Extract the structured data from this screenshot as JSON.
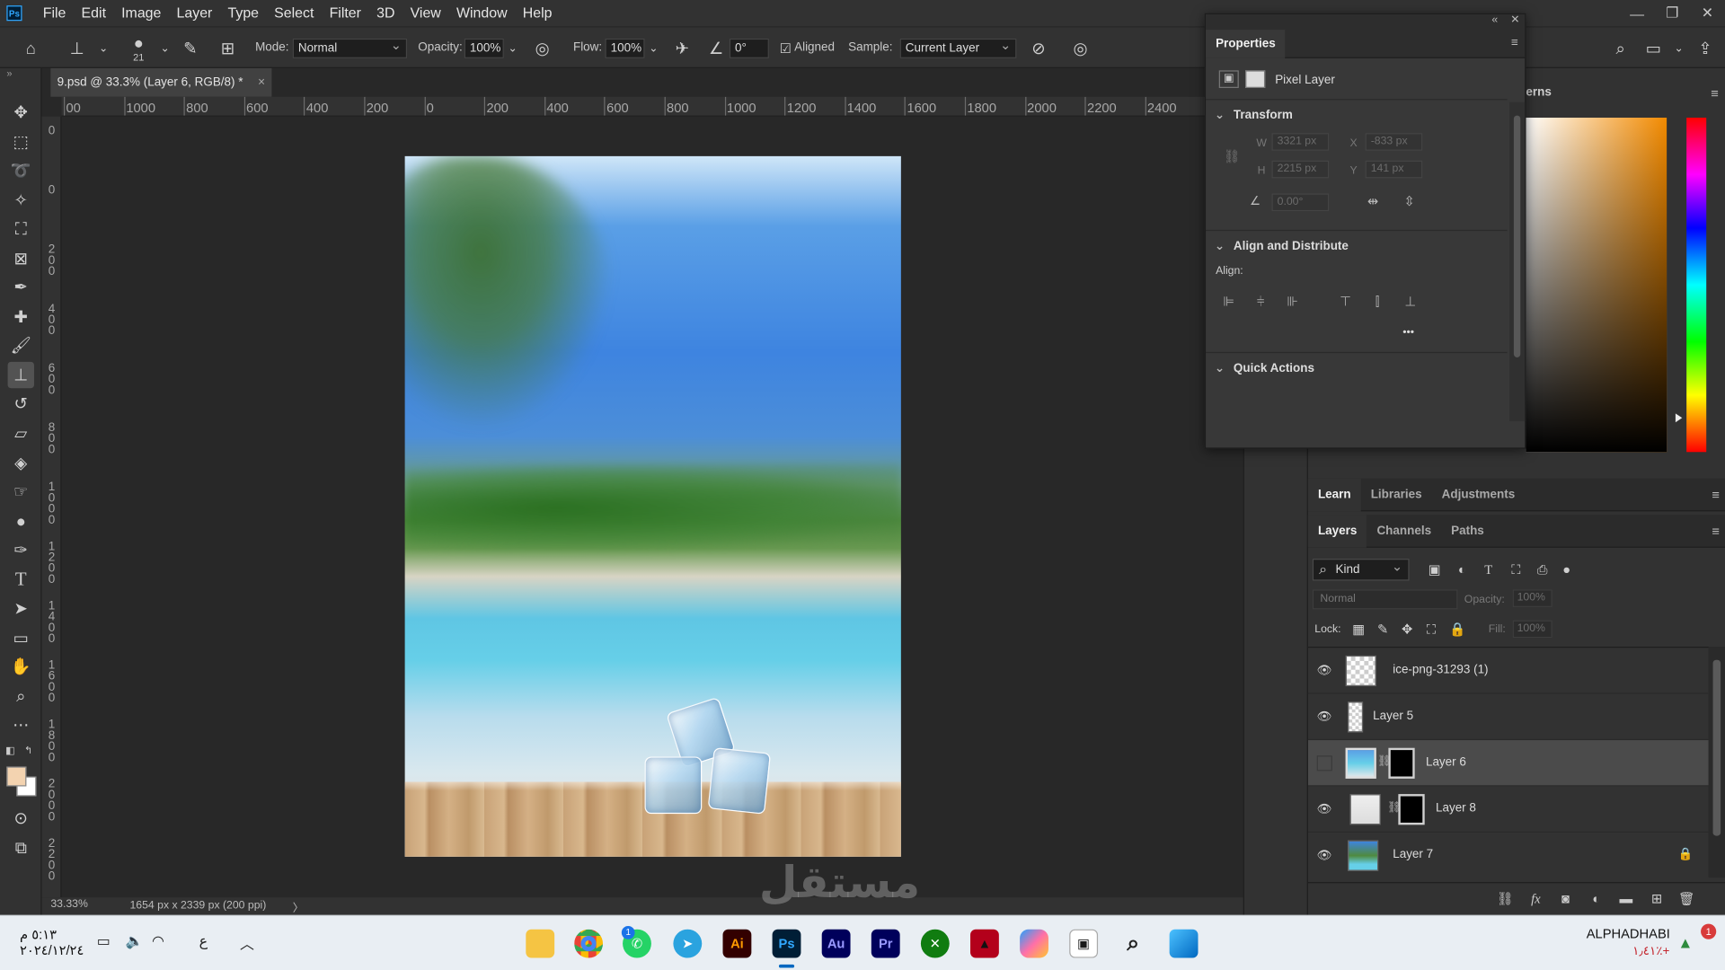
{
  "app": {
    "logo_text": "Ps"
  },
  "menu": {
    "items": [
      "File",
      "Edit",
      "Image",
      "Layer",
      "Type",
      "Select",
      "Filter",
      "3D",
      "View",
      "Window",
      "Help"
    ]
  },
  "window_controls": {
    "minimize": "—",
    "restore": "❐",
    "close": "✕"
  },
  "options_bar": {
    "brush_size": "21",
    "mode_label": "Mode:",
    "mode_value": "Normal",
    "opacity_label": "Opacity:",
    "opacity_value": "100%",
    "flow_label": "Flow:",
    "flow_value": "100%",
    "angle_value": "0°",
    "aligned_label": "Aligned",
    "aligned_checked": true,
    "sample_label": "Sample:",
    "sample_value": "Current Layer"
  },
  "document": {
    "tab_title": "9.psd @ 33.3% (Layer 6, RGB/8) *",
    "close_glyph": "×",
    "zoom": "33.33%",
    "info": "1654 px x 2339 px (200 ppi)",
    "info_arrow": "〉"
  },
  "ruler": {
    "h_ticks": [
      "00",
      "1000",
      "800",
      "600",
      "400",
      "200",
      "0",
      "200",
      "400",
      "600",
      "800",
      "1000",
      "1200",
      "1400",
      "1600",
      "1800",
      "2000",
      "2200",
      "2400",
      "26"
    ],
    "v_ticks": [
      "0",
      "0",
      "2\n0\n0",
      "4\n0\n0",
      "6\n0\n0",
      "8\n0\n0",
      "1\n0\n0\n0",
      "1\n2\n0\n0",
      "1\n4\n0\n0",
      "1\n6\n0\n0",
      "1\n8\n0\n0",
      "2\n0\n0\n0",
      "2\n2\n0\n0",
      "2\n4\n0\n0",
      "2"
    ]
  },
  "tools": [
    "move-tool",
    "marquee-tool",
    "lasso-tool",
    "quick-select-tool",
    "crop-tool",
    "frame-tool",
    "eyedropper-tool",
    "healing-tool",
    "brush-tool",
    "clone-stamp-tool",
    "history-brush-tool",
    "eraser-tool",
    "paint-bucket-tool",
    "smudge-tool",
    "dodge-tool",
    "pen-tool",
    "type-tool",
    "path-select-tool",
    "rectangle-tool",
    "hand-tool",
    "zoom-tool",
    "more-tools"
  ],
  "colors": {
    "foreground": "#f3d3b0",
    "background": "#ffffff",
    "accent": "#31a8ff"
  },
  "properties": {
    "tab": "Properties",
    "collapse_glyph": "«",
    "close_glyph": "✕",
    "layer_kind": "Pixel Layer",
    "transform_title": "Transform",
    "w_label": "W",
    "w_value": "3321 px",
    "h_label": "H",
    "h_value": "2215 px",
    "x_label": "X",
    "x_value": "-833 px",
    "y_label": "Y",
    "y_value": "141 px",
    "angle_value": "0.00°",
    "align_title": "Align and Distribute",
    "align_label": "Align:",
    "more_glyph": "•••",
    "quick_actions_title": "Quick Actions"
  },
  "right_panel": {
    "patterns_tab_fragment": "erns",
    "tabs_top": [
      "Learn",
      "Libraries",
      "Adjustments"
    ],
    "tabs_layers": [
      "Layers",
      "Channels",
      "Paths"
    ]
  },
  "layers": {
    "kind_filter": "Kind",
    "blend_mode": "Normal",
    "opacity_label": "Opacity:",
    "opacity_value": "100%",
    "lock_label": "Lock:",
    "fill_label": "Fill:",
    "fill_value": "100%",
    "items": [
      {
        "name": "ice-png-31293 (1)",
        "visible": true,
        "selected": false,
        "has_mask": false,
        "locked": false
      },
      {
        "name": "Layer 5",
        "visible": true,
        "selected": false,
        "has_mask": false,
        "locked": false
      },
      {
        "name": "Layer 6",
        "visible": false,
        "selected": true,
        "has_mask": true,
        "locked": false
      },
      {
        "name": "Layer 8",
        "visible": true,
        "selected": false,
        "has_mask": true,
        "locked": false
      },
      {
        "name": "Layer 7",
        "visible": true,
        "selected": false,
        "has_mask": false,
        "locked": true
      }
    ]
  },
  "taskbar": {
    "time": "٥:١٣ م",
    "date": "٢٠٢٤/١٢/٢٤",
    "input_lang": "ع",
    "apps": [
      "file-explorer",
      "chrome",
      "whatsapp",
      "telegram",
      "illustrator",
      "photoshop",
      "audition",
      "premiere",
      "xbox",
      "app-red",
      "copilot",
      "app-white",
      "search",
      "start"
    ],
    "ai_label": "Ai",
    "ps_label": "Ps",
    "au_label": "Au",
    "pr_label": "Pr",
    "whatsapp_badge": "1",
    "user": "ALPHADHABI",
    "stock_change": "١٫٤١٪+",
    "notification_count": "1"
  },
  "watermark": {
    "text": "مستقل"
  }
}
